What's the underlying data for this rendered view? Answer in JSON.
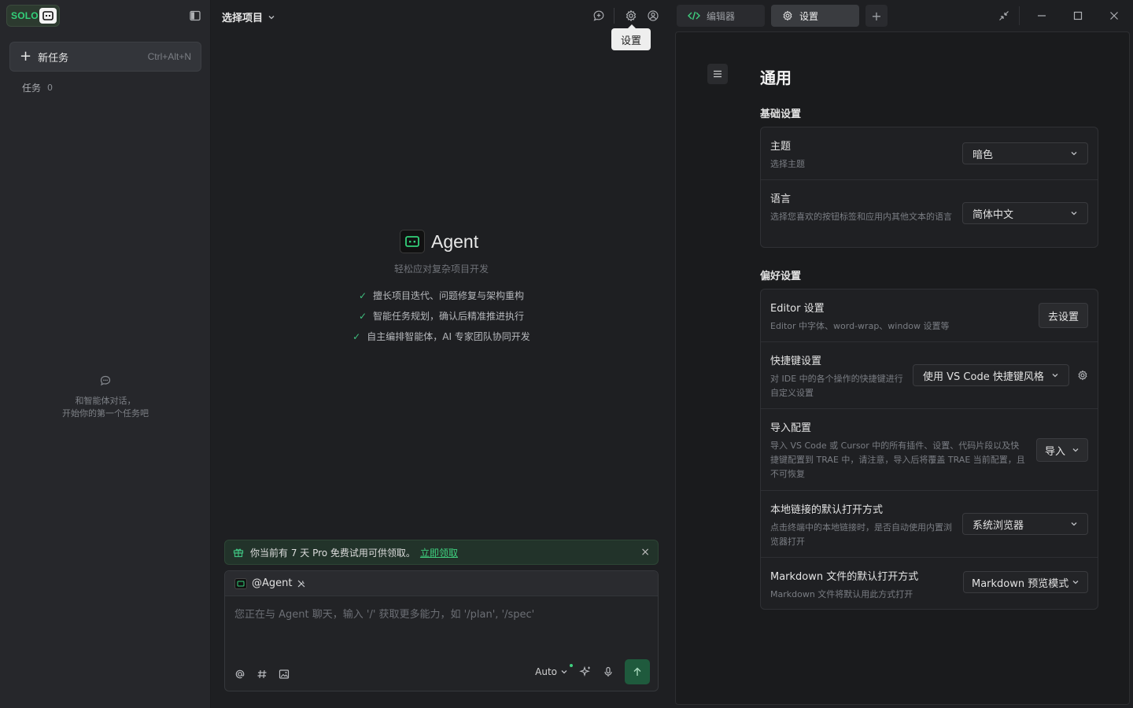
{
  "sidebar": {
    "badge": "SOLO",
    "new_task_label": "新任务",
    "new_task_shortcut": "Ctrl+Alt+N",
    "tasks_label": "任务",
    "tasks_count": "0",
    "empty_line1": "和智能体对话，",
    "empty_line2": "开始你的第一个任务吧"
  },
  "middle": {
    "project_select": "选择项目",
    "tooltip": "设置",
    "agent_name": "Agent",
    "agent_subtitle": "轻松应对复杂项目开发",
    "features": [
      "擅长项目迭代、问题修复与架构重构",
      "智能任务规划，确认后精准推进执行",
      "自主编排智能体，AI 专家团队协同开发"
    ],
    "promo_text": "你当前有 7 天 Pro 免费试用可供领取。",
    "promo_link": "立即领取",
    "composer_agent": "@Agent",
    "composer_placeholder": "您正在与 Agent 聊天，输入 '/' 获取更多能力，如 '/plan', '/spec'",
    "model_mode": "Auto"
  },
  "tabs": {
    "editor": "编辑器",
    "settings": "设置"
  },
  "settings": {
    "title": "通用",
    "basic_title": "基础设置",
    "pref_title": "偏好设置",
    "theme_label": "主题",
    "theme_desc": "选择主题",
    "theme_value": "暗色",
    "lang_label": "语言",
    "lang_desc": "选择您喜欢的按钮标签和应用内其他文本的语言",
    "lang_value": "简体中文",
    "editor_label": "Editor 设置",
    "editor_desc": "Editor 中字体、word-wrap、window 设置等",
    "editor_btn": "去设置",
    "keys_label": "快捷键设置",
    "keys_desc": "对 IDE 中的各个操作的快捷键进行自定义设置",
    "keys_value": "使用 VS Code 快捷键风格",
    "import_label": "导入配置",
    "import_desc": "导入 VS Code 或 Cursor 中的所有插件、设置、代码片段以及快捷键配置到 TRAE 中，请注意，导入后将覆盖 TRAE 当前配置，且不可恢复",
    "import_btn": "导入",
    "link_label": "本地链接的默认打开方式",
    "link_desc": "点击终端中的本地链接时，是否自动使用内置浏览器打开",
    "link_value": "系统浏览器",
    "md_label": "Markdown 文件的默认打开方式",
    "md_desc": "Markdown 文件将默认用此方式打开",
    "md_value": "Markdown 预览模式"
  },
  "colors": {
    "accent_green": "#3fd07f",
    "bg": "#1e1f22"
  }
}
